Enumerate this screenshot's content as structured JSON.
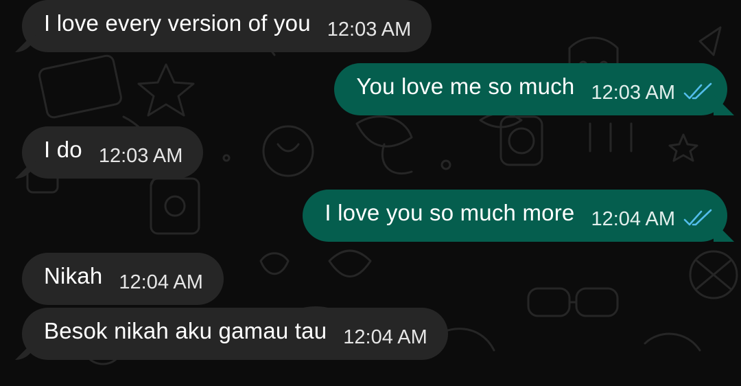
{
  "messages": [
    {
      "direction": "incoming",
      "text": "I love every version of you",
      "time": "12:03 AM"
    },
    {
      "direction": "outgoing",
      "text": "You love me so much",
      "time": "12:03 AM",
      "status": "read"
    },
    {
      "direction": "incoming",
      "text": "I do",
      "time": "12:03 AM"
    },
    {
      "direction": "outgoing",
      "text": "I love you so much more",
      "time": "12:04 AM",
      "status": "read"
    },
    {
      "direction": "incoming",
      "text": "Nikah",
      "time": "12:04 AM"
    },
    {
      "direction": "incoming",
      "text": "Besok nikah aku gamau tau",
      "time": "12:04 AM"
    }
  ],
  "colors": {
    "background": "#0c0c0c",
    "incoming_bubble": "#262626",
    "outgoing_bubble": "#055e4e",
    "read_ticks": "#53bdeb"
  },
  "icons": {
    "read_status": "double-check-icon",
    "wallpaper": "doodle-pattern"
  }
}
